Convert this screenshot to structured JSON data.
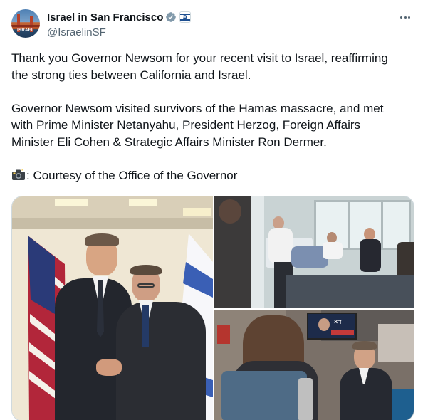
{
  "post": {
    "display_name": "Israel in San Francisco",
    "handle": "@IsraelinSF",
    "avatar_text": "ISRAEL",
    "paragraphs": [
      "Thank you Governor Newsom for your recent visit to Israel, reaffirming\nthe strong ties between California and Israel.",
      "Governor Newsom visited survivors of the Hamas massacre, and met\nwith Prime Minister Netanyahu, President Herzog, Foreign Affairs\nMinister Eli Cohen & Strategic Affairs Minister Ron Dermer."
    ],
    "credit": ": Courtesy of the Office of the Governor"
  },
  "media": {
    "photos": [
      {
        "name": "handshake-photo"
      },
      {
        "name": "hospital-visit-photo"
      },
      {
        "name": "survivor-meeting-photo"
      }
    ],
    "tv_screen_text": "×ד"
  },
  "icons": [
    "verified-icon",
    "government-affiliation-icon",
    "more-options-icon",
    "camera-icon"
  ],
  "colors": {
    "text": "#0f1419",
    "secondary_text": "#536471",
    "verified_badge": "#829aab",
    "border": "#cfd9de"
  }
}
